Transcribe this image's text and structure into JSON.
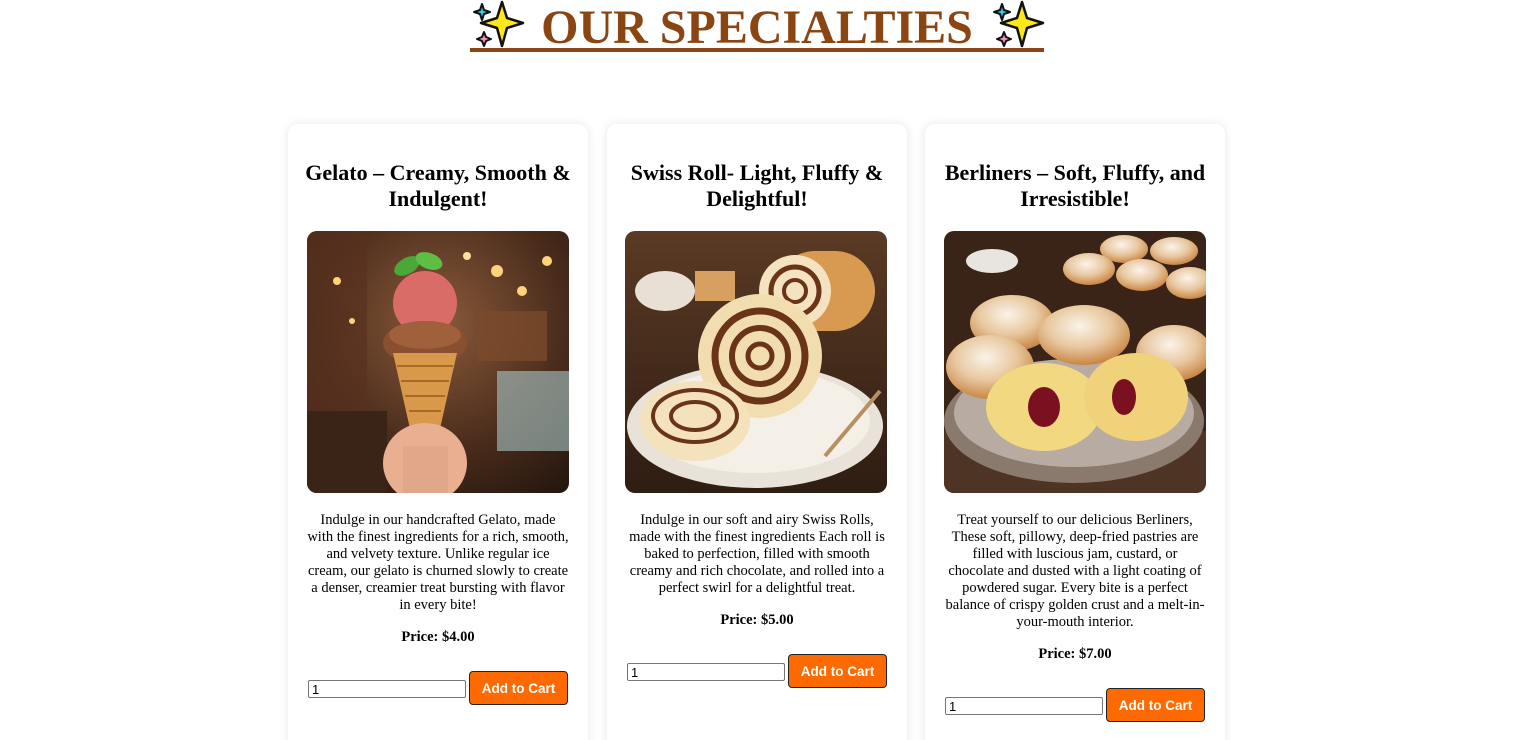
{
  "heading": {
    "title": "OUR SPECIALTIES",
    "color": "#8b4513",
    "icon": "sparkles-icon"
  },
  "products": [
    {
      "title": "Gelato – Creamy, Smooth & Indulgent!",
      "image": "gelato-cone-image",
      "description": "Indulge in our handcrafted Gelato, made with the finest ingredients for a rich, smooth, and velvety texture. Unlike regular ice cream, our gelato is churned slowly to create a denser, creamier treat bursting with flavor in every bite!",
      "price": "Price: $4.00",
      "quantity": "1",
      "button_label": "Add to Cart"
    },
    {
      "title": "Swiss Roll- Light, Fluffy & Delightful!",
      "image": "swiss-roll-image",
      "description": "Indulge in our soft and airy Swiss Rolls, made with the finest ingredients Each roll is baked to perfection, filled with smooth creamy and rich chocolate, and rolled into a perfect swirl for a delightful treat.",
      "price": "Price: $5.00",
      "quantity": "1",
      "button_label": "Add to Cart"
    },
    {
      "title": "Berliners – Soft, Fluffy, and Irresistible!",
      "image": "berliners-image",
      "description": "Treat yourself to our delicious Berliners, These soft, pillowy, deep-fried pastries are filled with luscious jam, custard, or chocolate and dusted with a light coating of powdered sugar. Every bite is a perfect balance of crispy golden crust and a melt-in-your-mouth interior.",
      "price": "Price: $7.00",
      "quantity": "1",
      "button_label": "Add to Cart"
    }
  ],
  "colors": {
    "button": "#ff6a00",
    "heading": "#8b4513"
  }
}
